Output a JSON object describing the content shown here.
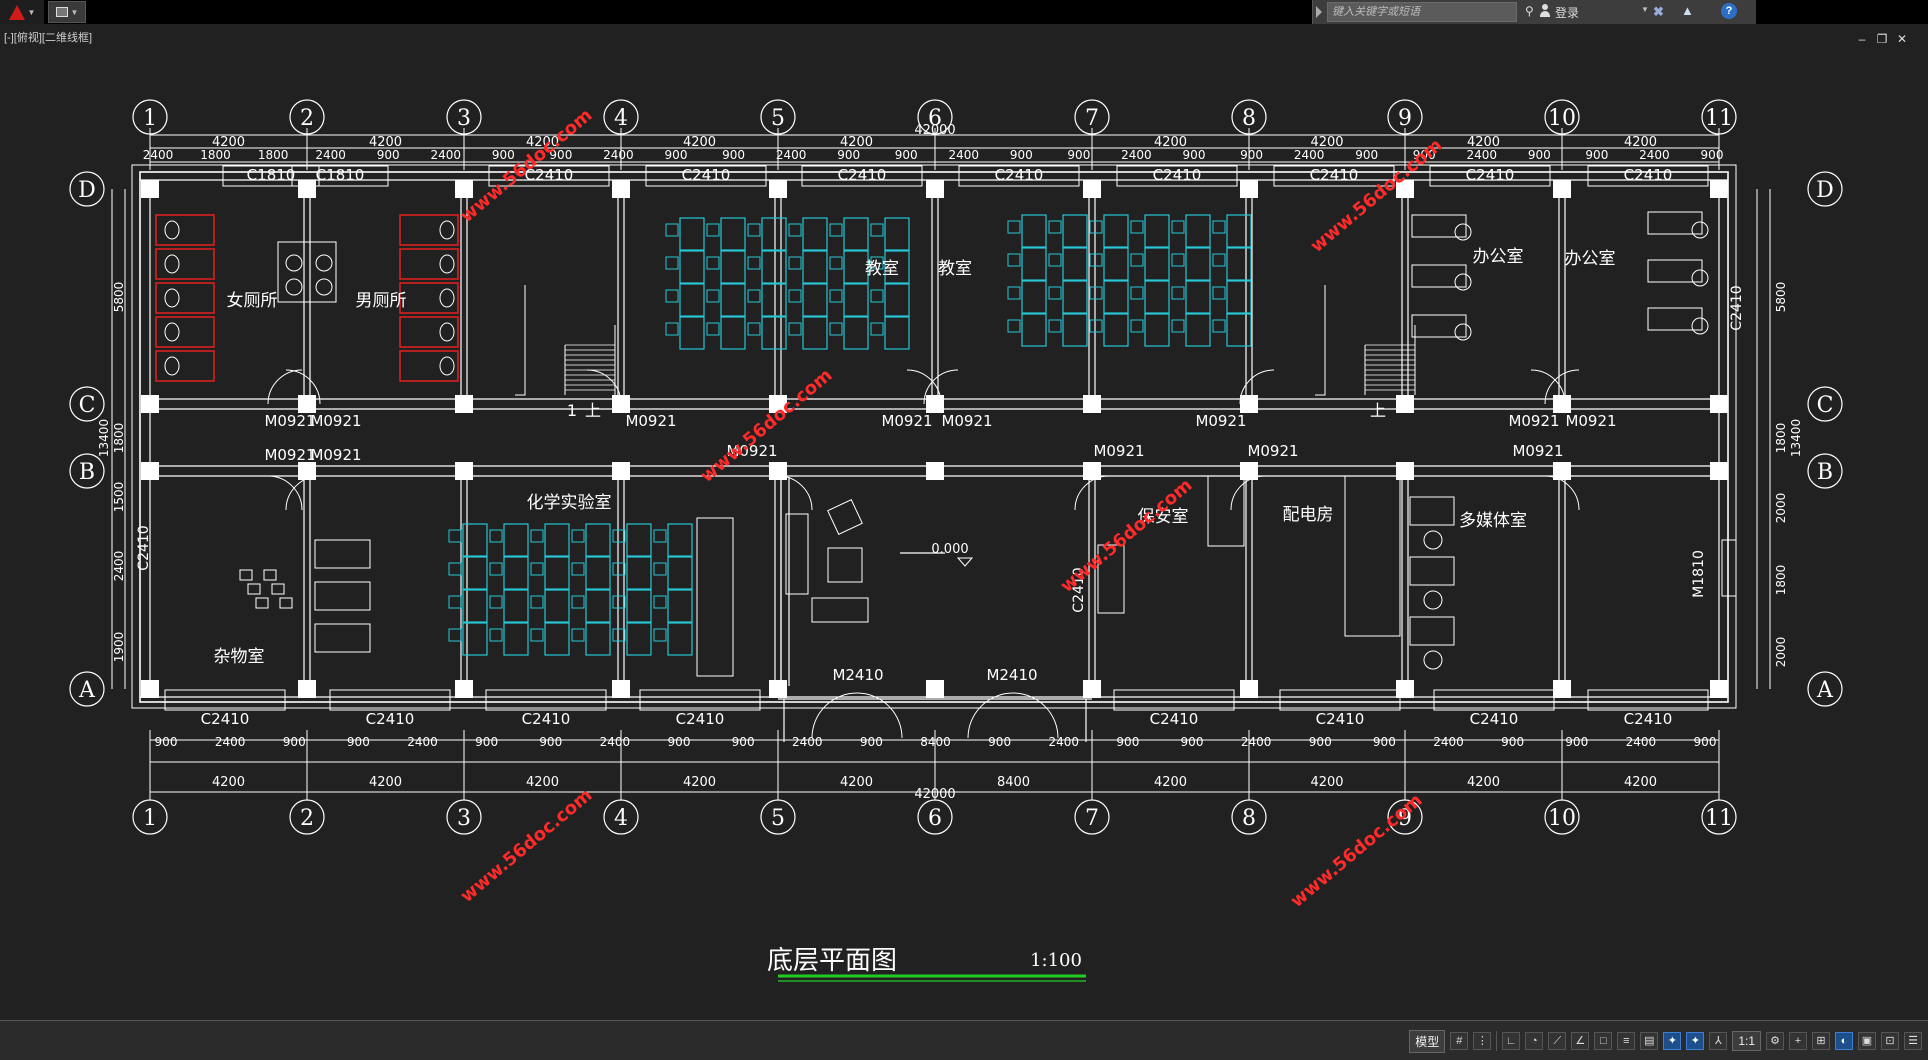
{
  "app": {
    "search_placeholder": "键入关键字或短语",
    "login_label": "登录",
    "viewport_label": "[-][俯视][二维线框]",
    "help_label": "?"
  },
  "drawing": {
    "title": "底层平面图",
    "scale": "1:100",
    "total_length": "42000",
    "total_depth": "13400",
    "axis_numbers": [
      "1",
      "2",
      "3",
      "4",
      "5",
      "6",
      "7",
      "8",
      "9",
      "10",
      "11"
    ],
    "axis_letters": [
      "D",
      "C",
      "B",
      "A"
    ],
    "span_dims": [
      "4200",
      "4200",
      "4200",
      "4200",
      "4200",
      "8400",
      "4200",
      "4200",
      "4200",
      "4200"
    ],
    "top_window_dims": [
      "2400",
      "1800",
      "1800",
      "2400",
      "900",
      "2400",
      "900",
      "900",
      "2400",
      "900",
      "900",
      "2400",
      "900",
      "900",
      "2400",
      "900",
      "900",
      "2400",
      "900",
      "900",
      "2400",
      "900",
      "900",
      "2400",
      "900",
      "900",
      "2400",
      "900"
    ],
    "top_windows": [
      "C1810",
      "C1810",
      "C2410",
      "C2410",
      "C2410",
      "C2410",
      "C2410",
      "C2410",
      "C2410",
      "C2410"
    ],
    "bottom_windows": [
      "C2410",
      "C2410",
      "C2410",
      "C2410",
      "C2410",
      "C2410",
      "C2410",
      "C2410"
    ],
    "bottom_window_dims": [
      "900",
      "2400",
      "900",
      "900",
      "2400",
      "900",
      "900",
      "2400",
      "900",
      "900",
      "2400",
      "900",
      "8400",
      "900",
      "2400",
      "900",
      "900",
      "2400",
      "900",
      "900",
      "2400",
      "900",
      "900",
      "2400",
      "900"
    ],
    "left_dims": [
      "5800",
      "1800",
      "1500",
      "2400",
      "1900"
    ],
    "right_dims": [
      "5800",
      "1800",
      "2000",
      "1800",
      "2000"
    ],
    "rooms": {
      "womens_toilet": "女厕所",
      "mens_toilet": "男厕所",
      "classroom_1": "教室",
      "classroom_2": "教室",
      "office_1": "办公室",
      "office_2": "办公室",
      "chem_lab": "化学实验室",
      "storage": "杂物室",
      "security": "保安室",
      "power": "配电房",
      "multimedia": "多媒体室"
    },
    "doors": [
      "M0921",
      "M0921",
      "M0921",
      "M0921",
      "M0921",
      "M0921",
      "M0921",
      "M0921",
      "M0921",
      "M0921",
      "M0921",
      "M0921",
      "M0921",
      "M0921",
      "M0921"
    ],
    "main_doors": [
      "M2410",
      "M2410"
    ],
    "side_windows": [
      "C2410",
      "C2410",
      "C2410",
      "M1810"
    ],
    "stair_up": "上",
    "stair_up_1": "1",
    "elevation": "0.000",
    "watermark": "www.56doc.com"
  },
  "statusbar": {
    "model_tab": "模型",
    "scale": "1:1"
  },
  "colors": {
    "line": "#ffffff",
    "furniture": "#27c7d6",
    "toilet": "#d92020",
    "watermark": "#ff2a2a",
    "title_underline": "#22cc22"
  }
}
